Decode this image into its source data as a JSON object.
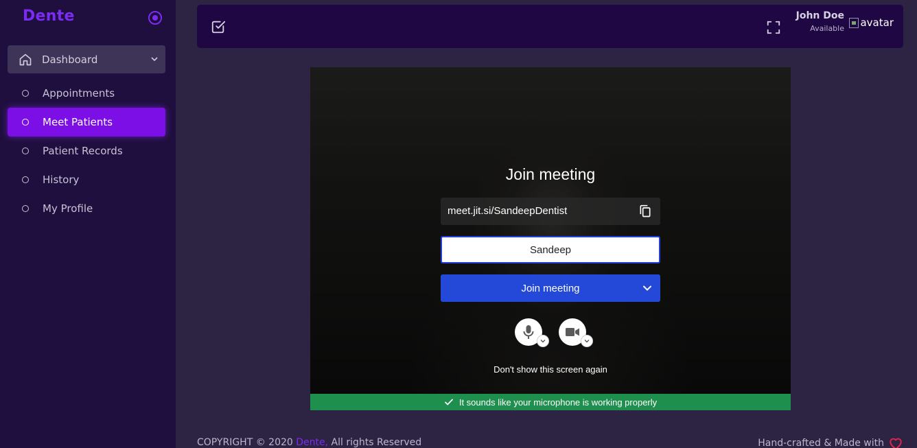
{
  "app": {
    "brand": "Dente"
  },
  "sidebar": {
    "dashboard_label": "Dashboard",
    "items": [
      {
        "label": "Appointments",
        "active": false
      },
      {
        "label": "Meet Patients",
        "active": true
      },
      {
        "label": "Patient Records",
        "active": false
      },
      {
        "label": "History",
        "active": false
      },
      {
        "label": "My Profile",
        "active": false
      }
    ]
  },
  "header": {
    "user_name": "John Doe",
    "user_status": "Available",
    "avatar_alt": "avatar"
  },
  "meeting": {
    "title": "Join meeting",
    "url": "meet.jit.si/SandeepDentist",
    "name_value": "Sandeep",
    "join_label": "Join meeting",
    "dont_show_label": "Don't show this screen again",
    "mic_status": "It sounds like your microphone is working properly",
    "mic_status_color": "#1f8f4e",
    "join_color": "#2449d8"
  },
  "footer": {
    "copyright_prefix": "COPYRIGHT © 2020",
    "copyright_brand": "Dente,",
    "copyright_suffix": "All rights Reserved",
    "made_with": "Hand-crafted & Made with"
  },
  "colors": {
    "accent": "#7c2bf5",
    "sidebar_bg": "#1f0f3e",
    "header_bg": "#1f0743",
    "page_bg": "#2c2442"
  }
}
